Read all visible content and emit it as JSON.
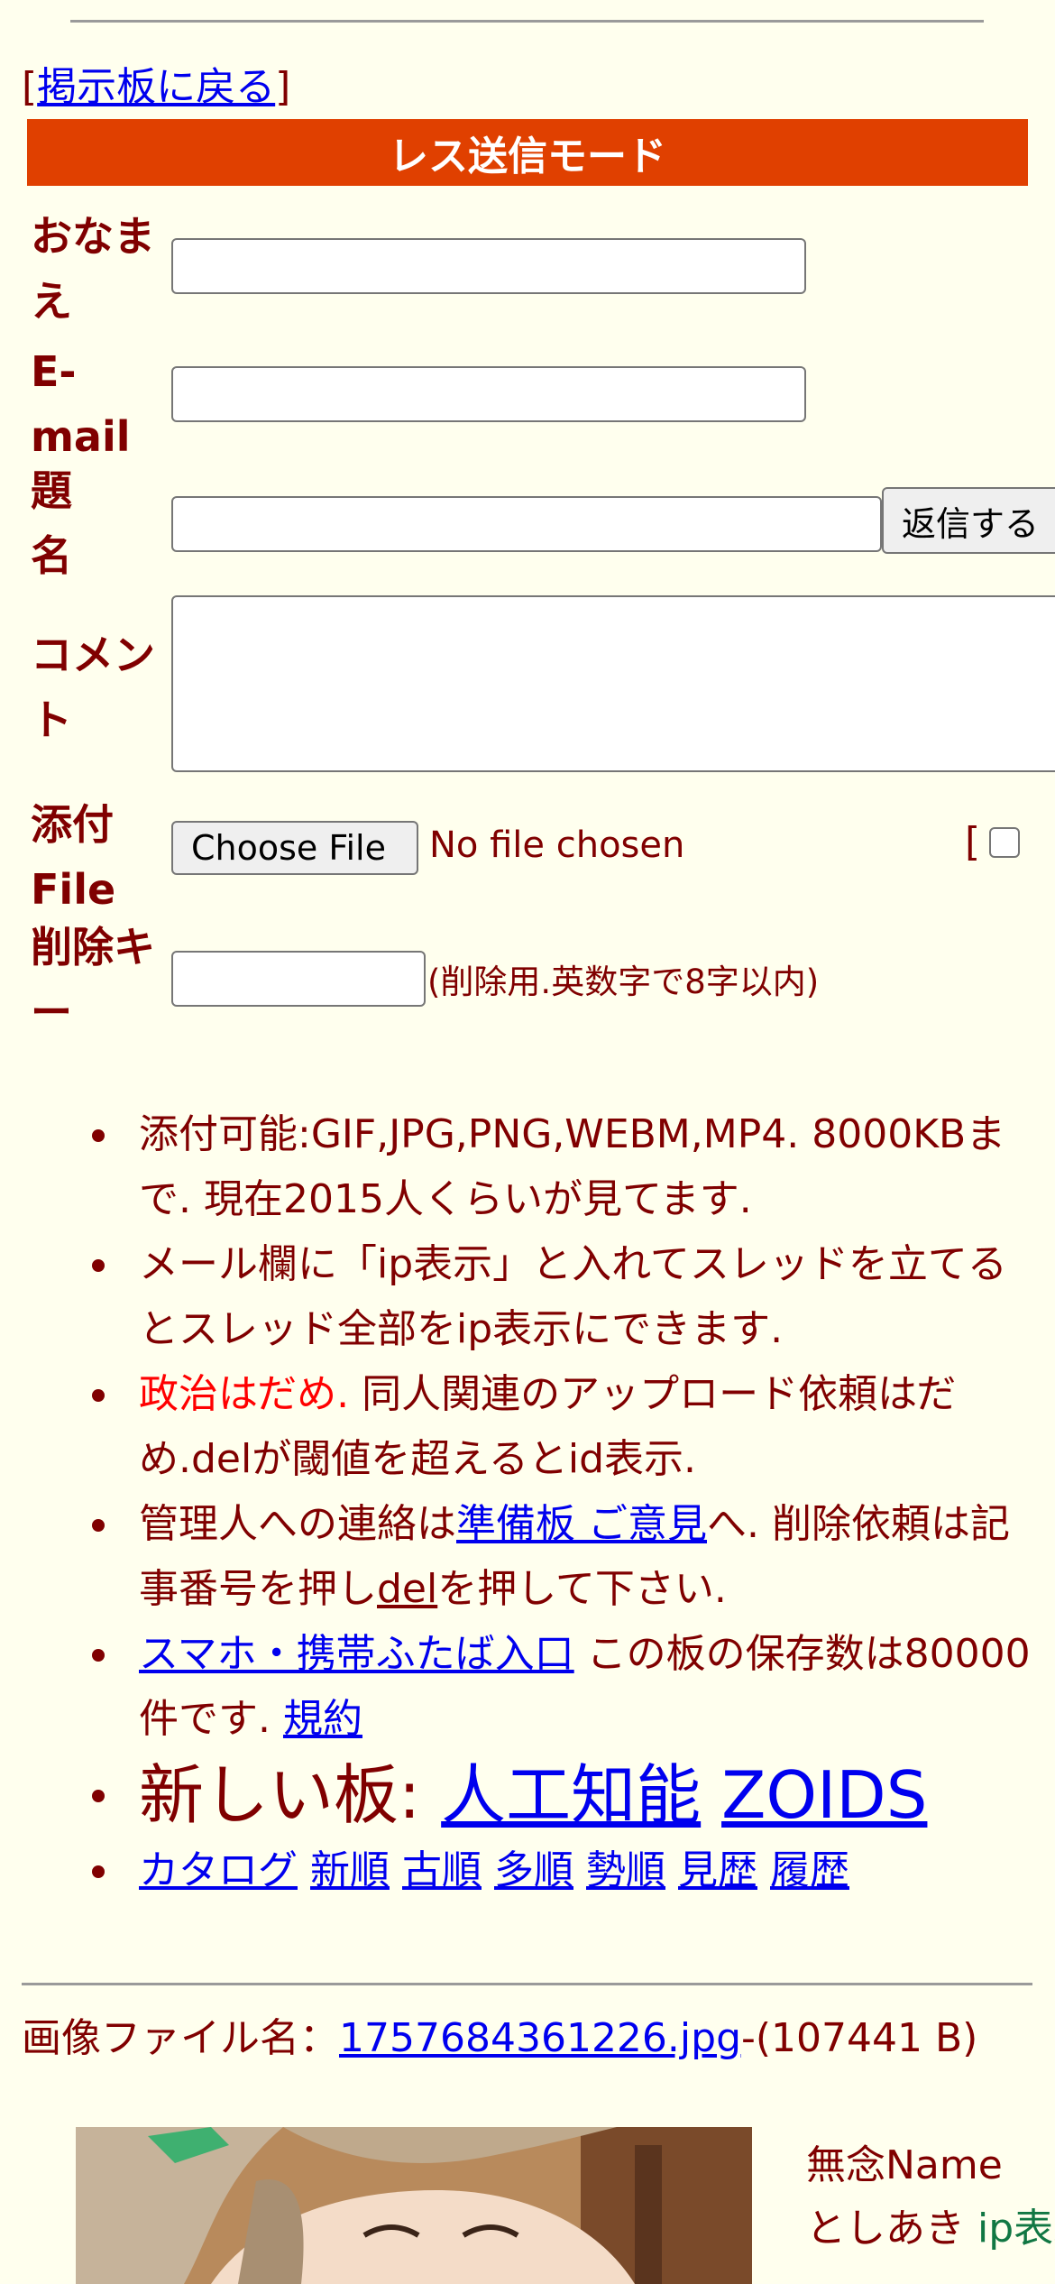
{
  "back": {
    "bracket_open": "[",
    "link": "掲示板に戻る",
    "bracket_close": "]"
  },
  "form": {
    "mode_title": "レス送信モード",
    "name_label": "おなまえ",
    "email_label": "E-mail",
    "subject_label": "題名",
    "submit_label": "返信する",
    "comment_label": "コメント",
    "attach_label": "添付File",
    "choose_file_label": "Choose File",
    "no_file_text": "No file chosen",
    "image_only_open": "[",
    "delkey_label": "削除キー",
    "delkey_hint": "(削除用.英数字で8字以内)"
  },
  "info": {
    "line1": "添付可能:GIF,JPG,PNG,WEBM,MP4. 8000KBまで. 現在2015人くらいが見てます.",
    "line2": "メール欄に「ip表示」と入れてスレッドを立てるとスレッド全部をip表示にできます.",
    "line3_red": "政治はだめ.",
    "line3_rest": " 同人関連のアップロード依頼はだめ.delが閾値を超えるとid表示.",
    "line4_pre": "管理人への連絡は",
    "line4_link1": "準備板 ご意見",
    "line4_mid": "へ. 削除依頼は記事番号を押し",
    "line4_link2": "del",
    "line4_post": "を押して下さい.",
    "line5_link": "スマホ・携帯ふたば入口",
    "line5_mid": " この板の保存数は80000件です. ",
    "line5_link2": "規約",
    "new_boards_label": "新しい板: ",
    "new_board1": "人工知能",
    "new_board2": "ZOIDS",
    "nav": [
      "カタログ",
      "新順",
      "古順",
      "多順",
      "勢順",
      "見歴",
      "履歴"
    ]
  },
  "post": {
    "file_label": "画像ファイル名：",
    "file_name": "1757684361226.jpg",
    "file_size": "-(107441 B)",
    "name": "無念Name",
    "poster": "としあき",
    "ip": "ip表示"
  },
  "colors": {
    "accent": "#e04000",
    "text": "#800000",
    "link": "#0000ee",
    "background": "#ffffee"
  }
}
